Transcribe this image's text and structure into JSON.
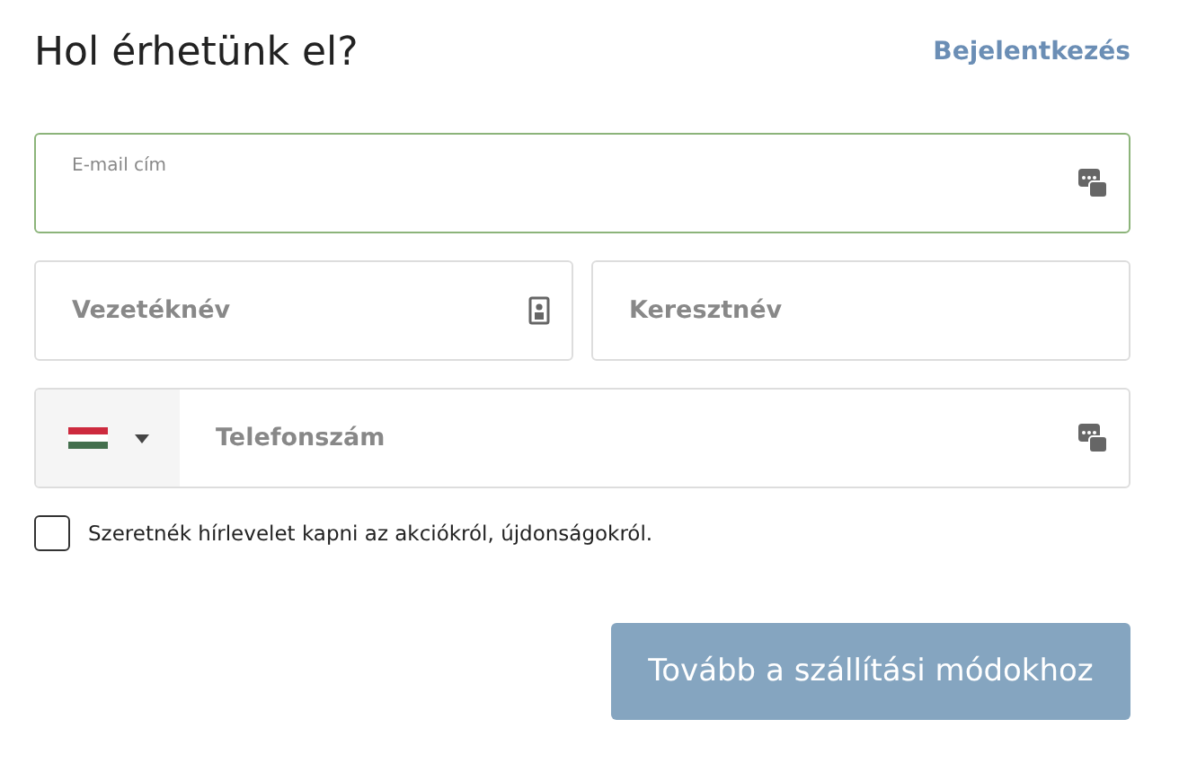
{
  "header": {
    "title": "Hol érhetünk el?",
    "login_link": "Bejelentkezés"
  },
  "email": {
    "label": "E-mail cím",
    "focused": true
  },
  "last_name": {
    "placeholder": "Vezetéknév"
  },
  "first_name": {
    "placeholder": "Keresztnév"
  },
  "phone": {
    "placeholder": "Telefonszám"
  },
  "newsletter": {
    "label": "Szeretnék hírlevelet kapni az akciókról, újdonságokról.",
    "checked": false
  },
  "submit": {
    "label": "Tovább a szállítási módokhoz",
    "disabled": true
  }
}
